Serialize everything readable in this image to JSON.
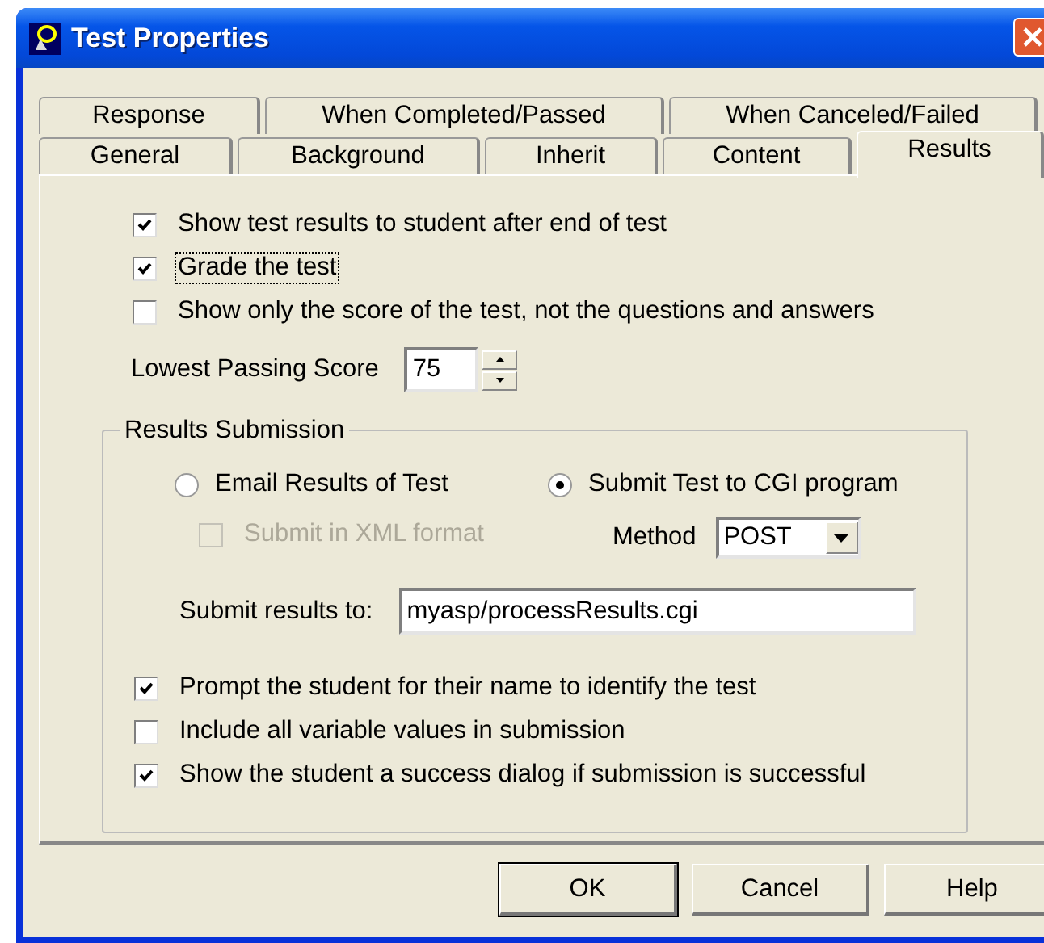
{
  "window": {
    "title": "Test Properties"
  },
  "tab_rows": [
    {
      "tabs": [
        {
          "label": "Response",
          "selected": false
        },
        {
          "label": "When Completed/Passed",
          "selected": false
        },
        {
          "label": "When Canceled/Failed",
          "selected": false
        }
      ]
    },
    {
      "tabs": [
        {
          "label": "General",
          "selected": false
        },
        {
          "label": "Background",
          "selected": false
        },
        {
          "label": "Inherit",
          "selected": false
        },
        {
          "label": "Content",
          "selected": false
        },
        {
          "label": "Results",
          "selected": true
        }
      ]
    }
  ],
  "options": [
    {
      "label": "Show test results to student after end of test",
      "checked": true,
      "focused": false
    },
    {
      "label": "Grade the test",
      "checked": true,
      "focused": true
    },
    {
      "label": "Show only the score of the test, not the questions and answers",
      "checked": false,
      "focused": false
    }
  ],
  "passing_score": {
    "label": "Lowest Passing Score",
    "value": "75"
  },
  "submission": {
    "title": "Results Submission",
    "methods": [
      {
        "label": "Email Results of Test",
        "selected": false
      },
      {
        "label": "Submit Test to CGI program",
        "selected": true
      }
    ],
    "xml": {
      "label": "Submit in XML format",
      "checked": false,
      "disabled": true
    },
    "method": {
      "label": "Method",
      "value": "POST"
    },
    "submit_to": {
      "label": "Submit results to:",
      "value": "myasp/processResults.cgi"
    },
    "options": [
      {
        "label": "Prompt the student for their name to identify the test",
        "checked": true
      },
      {
        "label": "Include all variable values in submission",
        "checked": false
      },
      {
        "label": "Show the student a success dialog if submission is successful",
        "checked": true
      }
    ]
  },
  "buttons": [
    {
      "label": "OK",
      "default": true
    },
    {
      "label": "Cancel",
      "default": false
    },
    {
      "label": "Help",
      "default": false
    }
  ]
}
